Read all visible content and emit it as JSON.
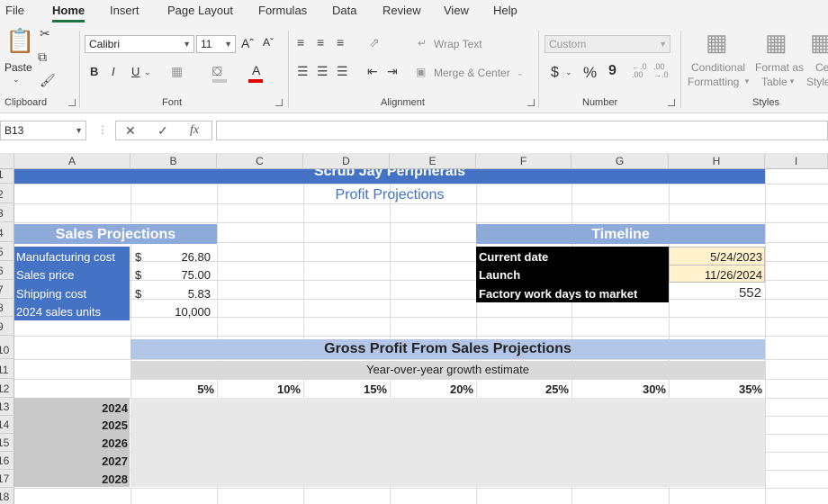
{
  "ribbon_tabs": [
    "File",
    "Home",
    "Insert",
    "Page Layout",
    "Formulas",
    "Data",
    "Review",
    "View",
    "Help"
  ],
  "active_tab": "Home",
  "clipboard": {
    "paste_label": "Paste",
    "group_label": "Clipboard"
  },
  "font": {
    "name": "Calibri",
    "size": "11",
    "bold": "B",
    "italic": "I",
    "underline": "U",
    "grow": "Aˆ",
    "shrink": "Aˇ",
    "font_color_letter": "A",
    "group_label": "Font"
  },
  "alignment": {
    "wrap_text": "Wrap Text",
    "merge_center": "Merge & Center",
    "group_label": "Alignment"
  },
  "number": {
    "format": "Custom",
    "currency": "$",
    "percent": "%",
    "comma": "9",
    "inc_dec": "←.0 .00",
    "dec_dec": ".00 →.0",
    "group_label": "Number"
  },
  "styles": {
    "conditional": "Conditional",
    "formatting": "Formatting",
    "format_as": "Format as",
    "table": "Table",
    "cell_styles_1": "Ce",
    "cell_styles_2": "Style",
    "group_label": "Styles"
  },
  "name_box": "B13",
  "fx_label": "fx",
  "columns": [
    "A",
    "B",
    "C",
    "D",
    "E",
    "F",
    "G",
    "H",
    "I"
  ],
  "rows": [
    "1",
    "2",
    "3",
    "4",
    "5",
    "6",
    "7",
    "8",
    "9",
    "10",
    "11",
    "12",
    "13",
    "14",
    "15",
    "16",
    "17",
    "18"
  ],
  "sheet": {
    "company": "Scrub Jay Peripherals",
    "subtitle": "Profit Projections",
    "sales_header": "Sales Projections",
    "sales_rows": [
      {
        "label": "Manufacturing cost",
        "sym": "$",
        "value": "26.80"
      },
      {
        "label": "Sales price",
        "sym": "$",
        "value": "75.00"
      },
      {
        "label": "Shipping cost",
        "sym": "$",
        "value": "5.83"
      },
      {
        "label": "2024 sales units",
        "sym": "",
        "value": "10,000"
      }
    ],
    "timeline_header": "Timeline",
    "timeline_rows": [
      {
        "label": "Current date",
        "value": "5/24/2023"
      },
      {
        "label": "Launch",
        "value": "11/26/2024"
      },
      {
        "label": "Factory work days to market",
        "value": "552"
      }
    ],
    "gross_header": "Gross Profit From Sales Projections",
    "growth_label": "Year-over-year growth estimate",
    "growth_rates": [
      "5%",
      "10%",
      "15%",
      "20%",
      "25%",
      "30%",
      "35%"
    ],
    "years": [
      "2024",
      "2025",
      "2026",
      "2027",
      "2028"
    ]
  },
  "colors": {
    "title_blue": "#4472c4",
    "subtitle_text": "#4472c4",
    "header_lightblue": "#8eaadb",
    "gross_header_bg": "#b4c6e7",
    "grey_band": "#d9d9d9",
    "table_grey": "#e8e8e8",
    "year_grey": "#c9c9c9",
    "date_yellow": "#fff2cc",
    "accent_green": "#217346"
  }
}
